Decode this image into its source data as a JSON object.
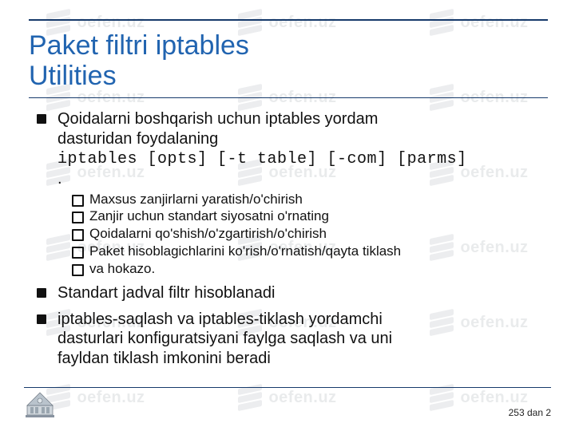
{
  "watermark_text": "oefen.uz",
  "title_line1": "Paket filtri iptables",
  "title_line2": "Utilities",
  "bullets": {
    "b1_line1": "Qoidalarni boshqarish uchun iptables yordam",
    "b1_line2": "dasturidan foydalaning",
    "b1_code": "iptables [opts] [-t table] [-com] [parms]",
    "b1_trail": ".",
    "sub": {
      "s1": "Maxsus zanjirlarni yaratish/o'chirish",
      "s2": "Zanjir uchun standart siyosatni o'rnating",
      "s3": "Qoidalarni qo'shish/o'zgartirish/o'chirish",
      "s4": "Paket hisoblagichlarini ko'rish/o'rnatish/qayta tiklash",
      "s5": "va hokazo."
    },
    "b2": "Standart jadval filtr hisoblanadi",
    "b3_line1": "iptables-saqlash va iptables-tiklash yordamchi",
    "b3_line2": "dasturlari konfiguratsiyani faylga saqlash va uni",
    "b3_line3": "fayldan tiklash imkonini beradi"
  },
  "page_label": "253 dan 2"
}
